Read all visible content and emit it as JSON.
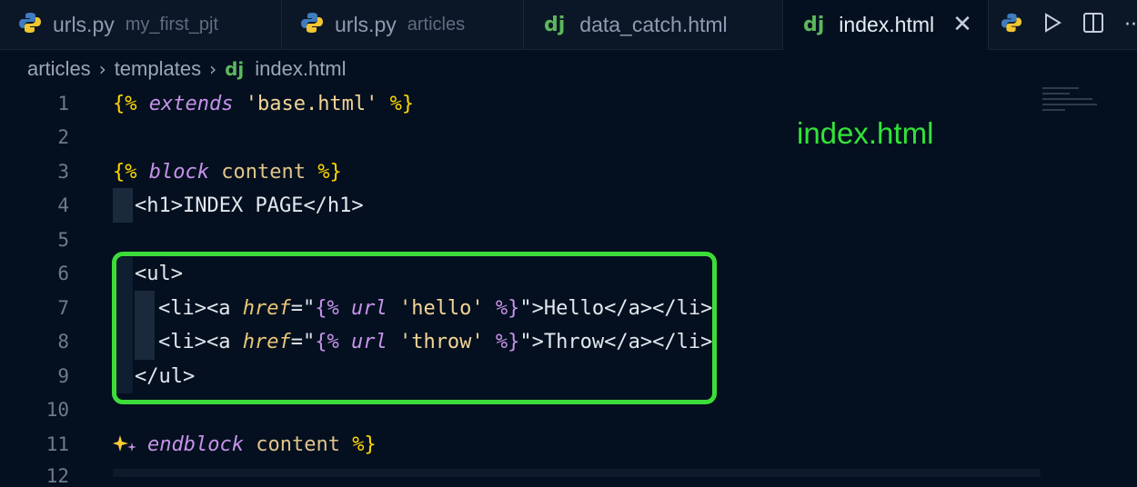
{
  "tabs": [
    {
      "label": "urls.py",
      "dir": "my_first_pjt",
      "icon": "python-icon",
      "active": false
    },
    {
      "label": "urls.py",
      "dir": "articles",
      "icon": "python-icon",
      "active": false
    },
    {
      "label": "data_catch.html",
      "icon": "django-icon",
      "active": false
    },
    {
      "label": "index.html",
      "icon": "django-icon",
      "active": true
    }
  ],
  "dj_glyph": "dj",
  "close_glyph": "✕",
  "actions": {
    "more": "···"
  },
  "breadcrumb": {
    "items": [
      "articles",
      "templates",
      "index.html"
    ],
    "separator": "›"
  },
  "annotation": "index.html",
  "line_numbers": [
    "1",
    "2",
    "3",
    "4",
    "5",
    "6",
    "7",
    "8",
    "9",
    "10",
    "11",
    "12"
  ],
  "code": {
    "l1": {
      "open": "{%",
      "kw": "extends",
      "str": "'base.html'",
      "close": "%}"
    },
    "l3": {
      "open": "{%",
      "kw": "block",
      "name": "content",
      "close": "%}"
    },
    "l4": {
      "tag_open": "<h1>",
      "text": "INDEX PAGE",
      "tag_close": "</h1>"
    },
    "l6": {
      "tag": "<ul>"
    },
    "l7": {
      "li_open": "<li><a ",
      "attr": "href",
      "eq": "=\"",
      "open": "{%",
      "kw": "url",
      "str": "'hello'",
      "close": "%}",
      "end": "\">",
      "text": "Hello",
      "tail": "</a></li>"
    },
    "l8": {
      "li_open": "<li><a ",
      "attr": "href",
      "eq": "=\"",
      "open": "{%",
      "kw": "url",
      "str": "'throw'",
      "close": "%}",
      "end": "\">",
      "text": "Throw",
      "tail": "</a></li>"
    },
    "l9": {
      "tag": "</ul>"
    },
    "l11": {
      "kw": "endblock",
      "name": "content",
      "close": "%}"
    }
  },
  "colors": {
    "background": "#04101f",
    "highlight_box": "#3ddc3a",
    "annotation": "#34e23a",
    "template_delim": "#ffd700",
    "keyword": "#c792ea"
  }
}
